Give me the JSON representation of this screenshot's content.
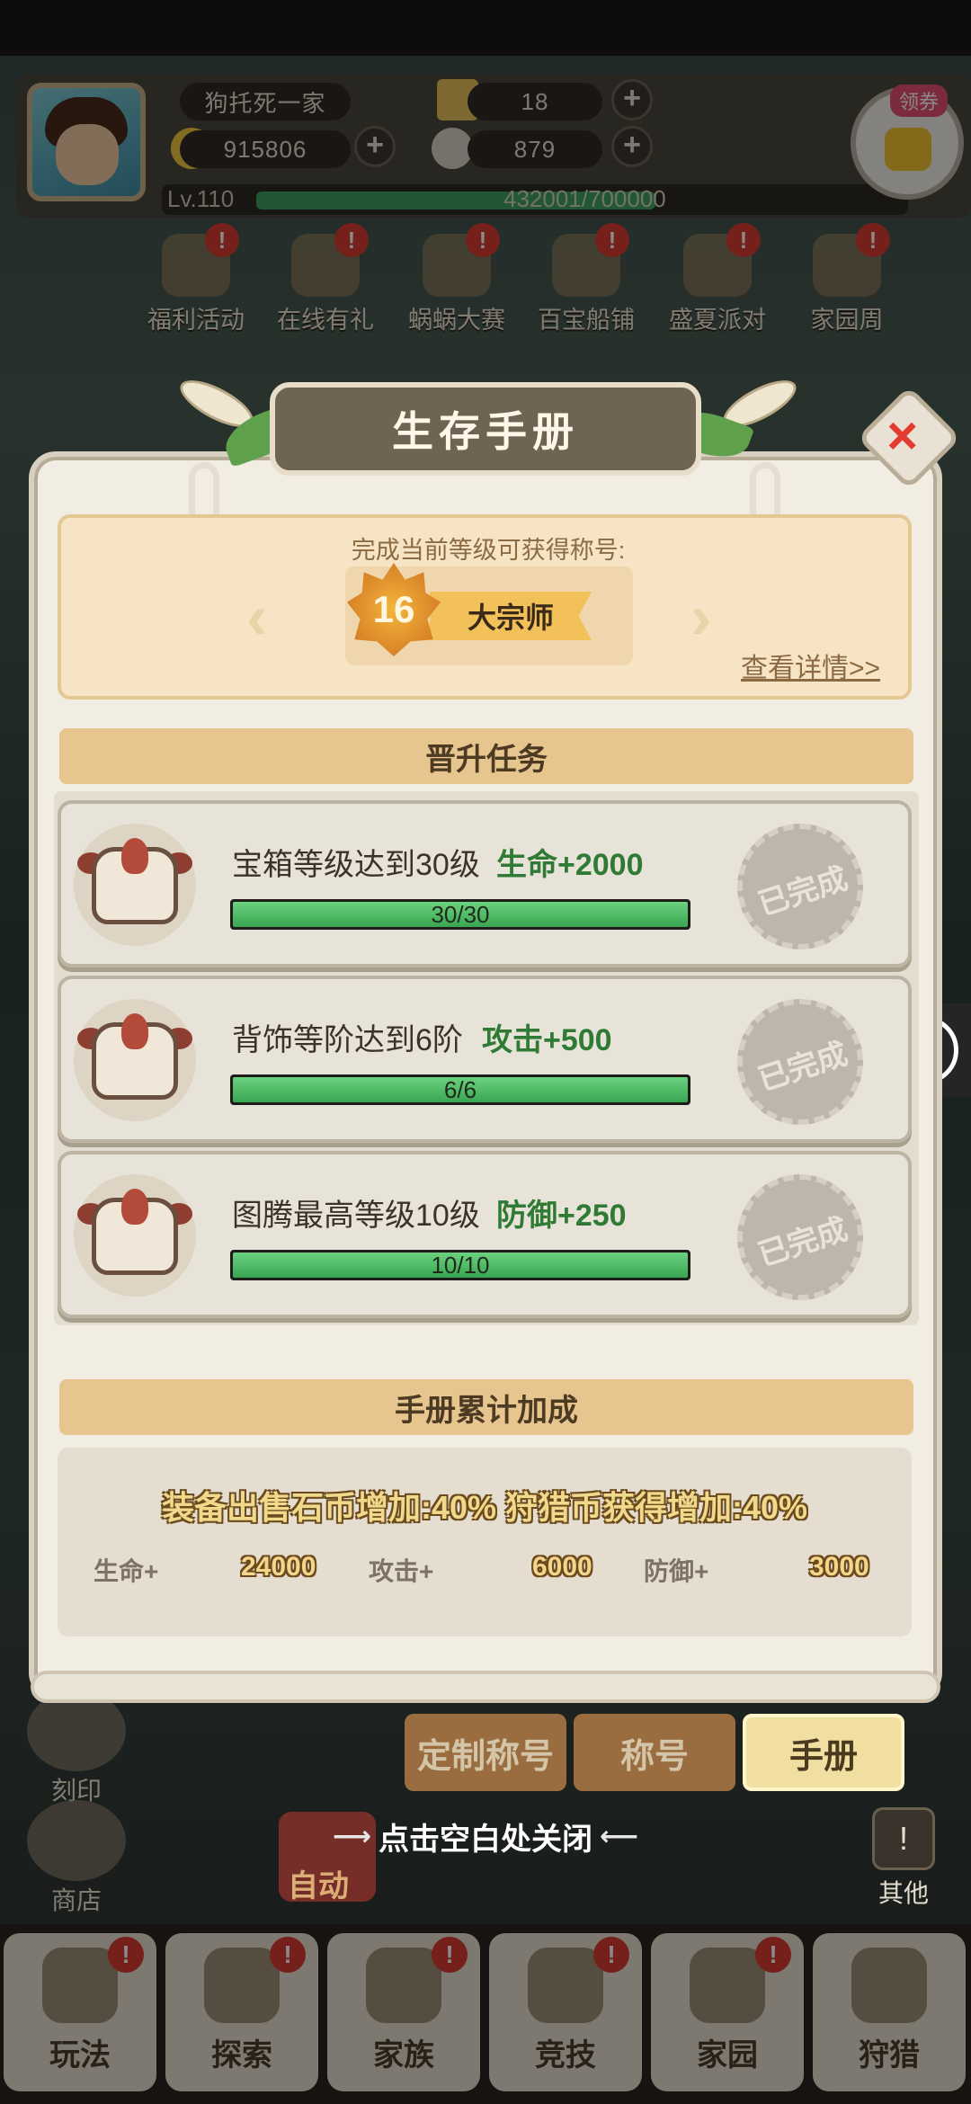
{
  "header": {
    "player_name": "狗托死一家",
    "coins": "915806",
    "tickets": "18",
    "shells": "879",
    "level_label": "Lv.110",
    "exp_text": "432001/700000",
    "exp_progress": 0.617,
    "coupon_label": "领券"
  },
  "events": [
    {
      "label": "福利活动",
      "badge": "!"
    },
    {
      "label": "在线有礼",
      "badge": "!"
    },
    {
      "label": "蜗蜗大赛",
      "badge": "!"
    },
    {
      "label": "百宝船铺",
      "badge": "!"
    },
    {
      "label": "盛夏派对",
      "badge": "!"
    },
    {
      "label": "家园周",
      "badge": "!"
    }
  ],
  "modal": {
    "title": "生存手册",
    "reward_caption": "完成当前等级可获得称号:",
    "badge_level": "16",
    "badge_title": "大宗师",
    "detail_link": "查看详情>>",
    "tasks_header": "晋升任务",
    "tasks": [
      {
        "title": "宝箱等级达到30级",
        "reward": "生命+2000",
        "progress_text": "30/30",
        "progress": 1.0,
        "status": "已完成"
      },
      {
        "title": "背饰等阶达到6阶",
        "reward": "攻击+500",
        "progress_text": "6/6",
        "progress": 1.0,
        "status": "已完成"
      },
      {
        "title": "图腾最高等级10级",
        "reward": "防御+250",
        "progress_text": "10/10",
        "progress": 1.0,
        "status": "已完成"
      }
    ],
    "bonus_header": "手册累计加成",
    "bonus_headline": "装备出售石币增加:40%  狩猎币获得增加:40%",
    "bonus_stats": [
      {
        "label": "生命+",
        "value": "24000"
      },
      {
        "label": "攻击+",
        "value": "6000"
      },
      {
        "label": "防御+",
        "value": "3000"
      }
    ]
  },
  "under_tabs": [
    "定制称号",
    "称号",
    "手册"
  ],
  "close_hint": "点击空白处关闭",
  "side": {
    "engrave": "刻印",
    "shop": "商店",
    "other": "其他",
    "auto": "自动"
  },
  "bottom_tabs": [
    {
      "label": "玩法",
      "badge": "!"
    },
    {
      "label": "探索",
      "badge": "!"
    },
    {
      "label": "家族",
      "badge": "!"
    },
    {
      "label": "竞技",
      "badge": "!"
    },
    {
      "label": "家园",
      "badge": "!"
    },
    {
      "label": "狩猎",
      "badge": "!"
    }
  ],
  "colors": {
    "accent_green": "#3aa651",
    "reward_green": "#2f7a35",
    "alert_red": "#d83b33",
    "section_tan": "#e6c58f"
  },
  "icons": [
    "avatar",
    "coin-icon",
    "ticket-icon",
    "shell-icon",
    "plus-icon",
    "coupon-icon",
    "close-icon",
    "play-icon",
    "totem-icon"
  ]
}
